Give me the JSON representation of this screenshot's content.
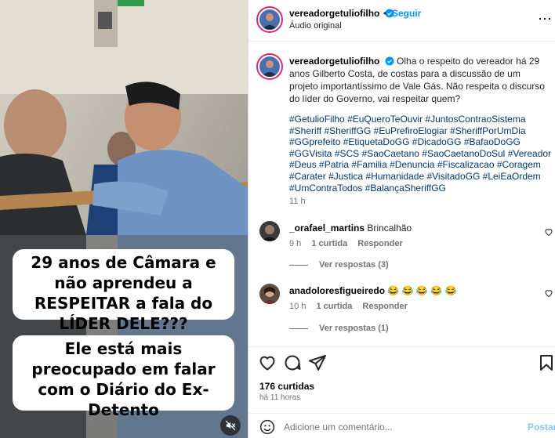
{
  "media": {
    "caption1": "29 anos de Câmara e não aprendeu a RESPEITAR a fala do LÍDER DELE???",
    "caption2": "Ele está mais preocupado em falar com o Diário do Ex-Detento"
  },
  "header": {
    "username": "vereadorgetuliofilho",
    "separator": "•",
    "follow_label": "Seguir",
    "audio_label": "Áudio original",
    "more_label": "⋯"
  },
  "post": {
    "username": "vereadorgetuliofilho",
    "caption": "Olha o respeito do vereador há 29 anos Gilberto Costa, de costas para a discussão de um projeto importantíssimo de Vale Gás. Não respeita o discurso do líder do Governo, vai respeitar quem?",
    "hashtags": [
      "#GetulioFilho",
      "#EuQueroTeOuvir",
      "#JuntosContraoSistema",
      "#Sheriff",
      "#SheriffGG",
      "#EuPrefiroElogiar",
      "#SheriffPorUmDia",
      "#GGprefeito",
      "#EtiquetaDoGG",
      "#DicadoGG",
      "#BafaoDoGG",
      "#GGVisita",
      "#SCS",
      "#SaoCaetano",
      "#SaoCaetanoDoSul",
      "#Vereador",
      "#Deus",
      "#Patria",
      "#Familia",
      "#Denuncia",
      "#Fiscalizacao",
      "#Coragem",
      "#Carater",
      "#Justica",
      "#Humanidade",
      "#VisitadoGG",
      "#LeiEaOrdem",
      "#UmContraTodos",
      "#BalançaSheriffGG"
    ],
    "time": "11 h"
  },
  "comments": [
    {
      "username": "_orafael_martins",
      "text": "Brincalhão",
      "time": "9 h",
      "likes": "1 curtida",
      "reply": "Responder",
      "view_replies": "Ver respostas (3)"
    },
    {
      "username": "anadoloresfigueiredo",
      "text": "😂 😂 😂 😂 😂",
      "time": "10 h",
      "likes": "1 curtida",
      "reply": "Responder",
      "view_replies": "Ver respostas (1)"
    }
  ],
  "footer": {
    "likes": "176 curtidas",
    "time_ago": "há 11 horas",
    "comment_placeholder": "Adicione um comentário...",
    "post_label": "Postar"
  },
  "colors": {
    "link_blue": "#0095f6",
    "hashtag": "#00376b",
    "muted": "#737373",
    "story_ring": "#d62976"
  }
}
